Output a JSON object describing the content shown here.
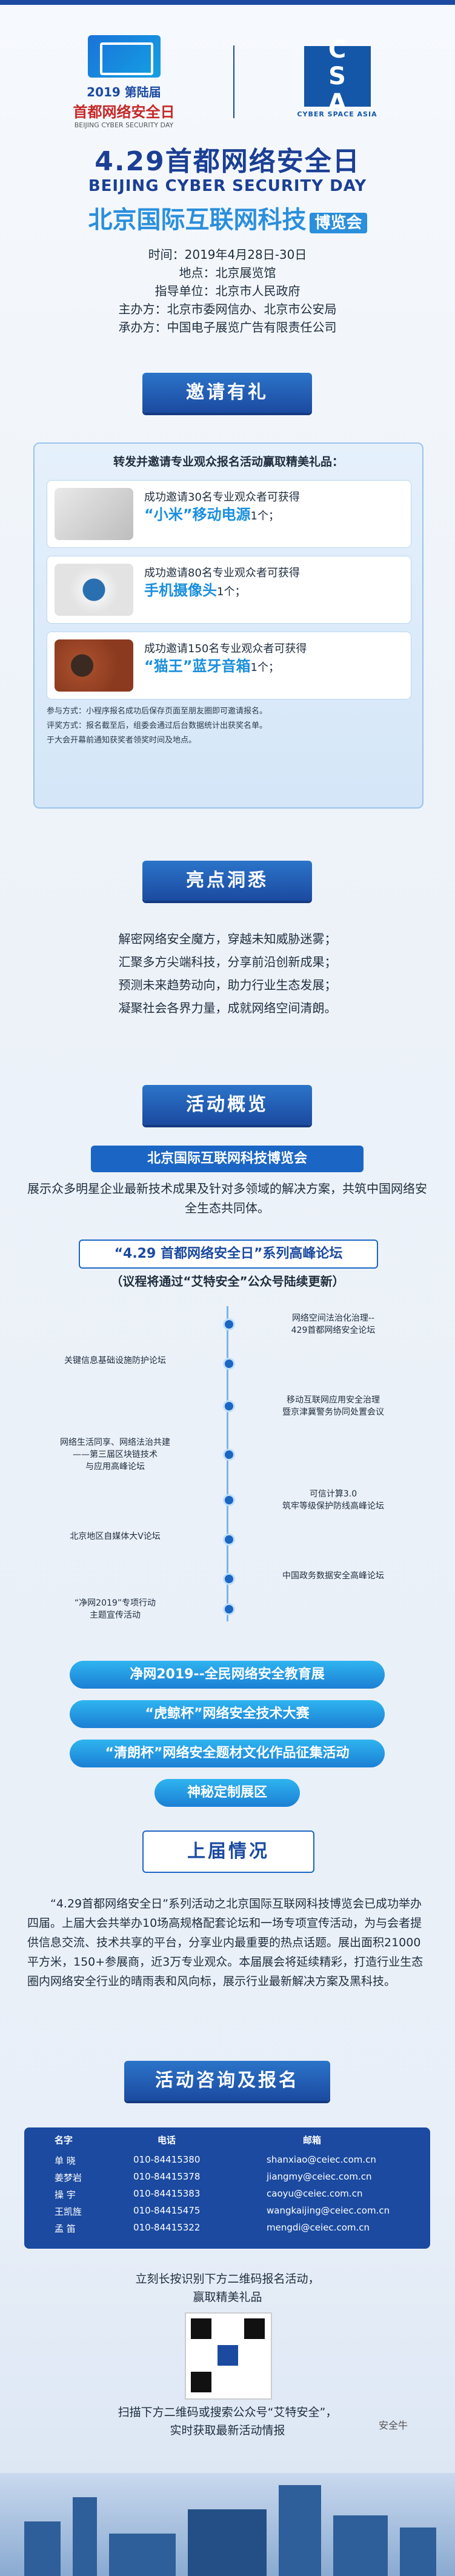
{
  "logos": {
    "left_year": "2019 第陆届",
    "left_name": "首都网络安全日",
    "left_en": "BEIJING CYBER SECURITY DAY",
    "right_letters": [
      "C",
      "S",
      "A"
    ],
    "right_sub": "CYBER SPACE ASIA"
  },
  "header": {
    "title": "4.29首都网络安全日",
    "subtitle": "BEIJING CYBER SECURITY DAY",
    "expo_title": "北京国际互联网科技",
    "expo_badge": "博览会"
  },
  "info": [
    "时间：2019年4月28日-30日",
    "地点：北京展览馆",
    "指导单位：北京市人民政府",
    "主办方：北京市委网信办、北京市公安局",
    "承办方：中国电子展览广告有限责任公司"
  ],
  "sections": {
    "invite": "邀请有礼",
    "highlights": "亮点洞悉",
    "overview": "活动概览",
    "previous": "上届情况",
    "contact": "活动咨询及报名"
  },
  "invite": {
    "intro": "转发并邀请专业观众报名活动赢取精美礼品：",
    "gifts": [
      {
        "text": "成功邀请30名专业观众者可获得",
        "prize": "“小米”移动电源",
        "suffix": "1个；",
        "icon": "power-bank-icon"
      },
      {
        "text": "成功邀请80名专业观众者可获得",
        "prize": "手机摄像头",
        "suffix": "1个；",
        "icon": "camera-icon"
      },
      {
        "text": "成功邀请150名专业观众者可获得",
        "prize": "“猫王”蓝牙音箱",
        "suffix": "1个；",
        "icon": "speaker-icon"
      }
    ],
    "notes": [
      "参与方式：小程序报名成功后保存页面至朋友圈即可邀请报名。",
      "评奖方式：报名截至后，组委会通过后台数据统计出获奖名单。",
      "于大会开幕前通知获奖者领奖时间及地点。"
    ]
  },
  "highlights": [
    "解密网络安全魔方，穿越未知威胁迷雾；",
    "汇聚多方尖端科技，分享前沿创新成果；",
    "预测未来趋势动向，助力行业生态发展；",
    "凝聚社会各界力量，成就网络空间清朗。"
  ],
  "overview": {
    "expo_title": "北京国际互联网科技博览会",
    "expo_desc": "展示众多明星企业最新技术成果及针对多领域的解决方案，共筑中国网络安全生态共同体。",
    "forum_title": "“4.29 首都网络安全日”系列高峰论坛",
    "forum_note": "（议程将通过“艾特安全”公众号陆续更新）",
    "forums_left": [
      "关键信息基础设施防护论坛",
      "网络生活同享、网络法治共建\n——第三届区块链技术\n与应用高峰论坛",
      "北京地区自媒体大V论坛",
      "“净网2019”专项行动\n主题宣传活动"
    ],
    "forums_right": [
      "网络空间法治化治理--\n429首都网络安全论坛",
      "移动互联网应用安全治理\n暨京津冀警务协同处置会议",
      "可信计算3.0\n筑牢等级保护防线高峰论坛",
      "中国政务数据安全高峰论坛"
    ],
    "activities": [
      "净网2019--全民网络安全教育展",
      "“虎鲸杯”网络安全技术大赛",
      "“清朗杯”网络安全题材文化作品征集活动",
      "神秘定制展区"
    ]
  },
  "previous": "“4.29首都网络安全日”系列活动之北京国际互联网科技博览会已成功举办四届。上届大会共举办10场高规格配套论坛和一场专项宣传活动，为与会者提供信息交流、技术共享的平台，分享业内最重要的热点话题。展出面积21000平方米，150+参展商，近3万专业观众。本届展会将延续精彩，打造行业生态圈内网络安全行业的晴雨表和风向标，展示行业最新解决方案及黑科技。",
  "contact": {
    "headers": [
      "名字",
      "电话",
      "邮箱"
    ],
    "rows": [
      [
        "单 晓",
        "010-84415380",
        "shanxiao@ceiec.com.cn"
      ],
      [
        "姜梦岩",
        "010-84415378",
        "jiangmy@ceiec.com.cn"
      ],
      [
        "操 宇",
        "010-84415383",
        "caoyu@ceiec.com.cn"
      ],
      [
        "王凯旌",
        "010-84415475",
        "wangkaijing@ceiec.com.cn"
      ],
      [
        "孟 笛",
        "010-84415322",
        "mengdi@ceiec.com.cn"
      ]
    ]
  },
  "qr": {
    "note1": "立刻长按识别下方二维码报名活动，\n赢取精美礼品",
    "note2": "扫描下方二维码或搜索公众号“艾特安全”，\n实时获取最新活动情报"
  },
  "watermark": "安全牛"
}
